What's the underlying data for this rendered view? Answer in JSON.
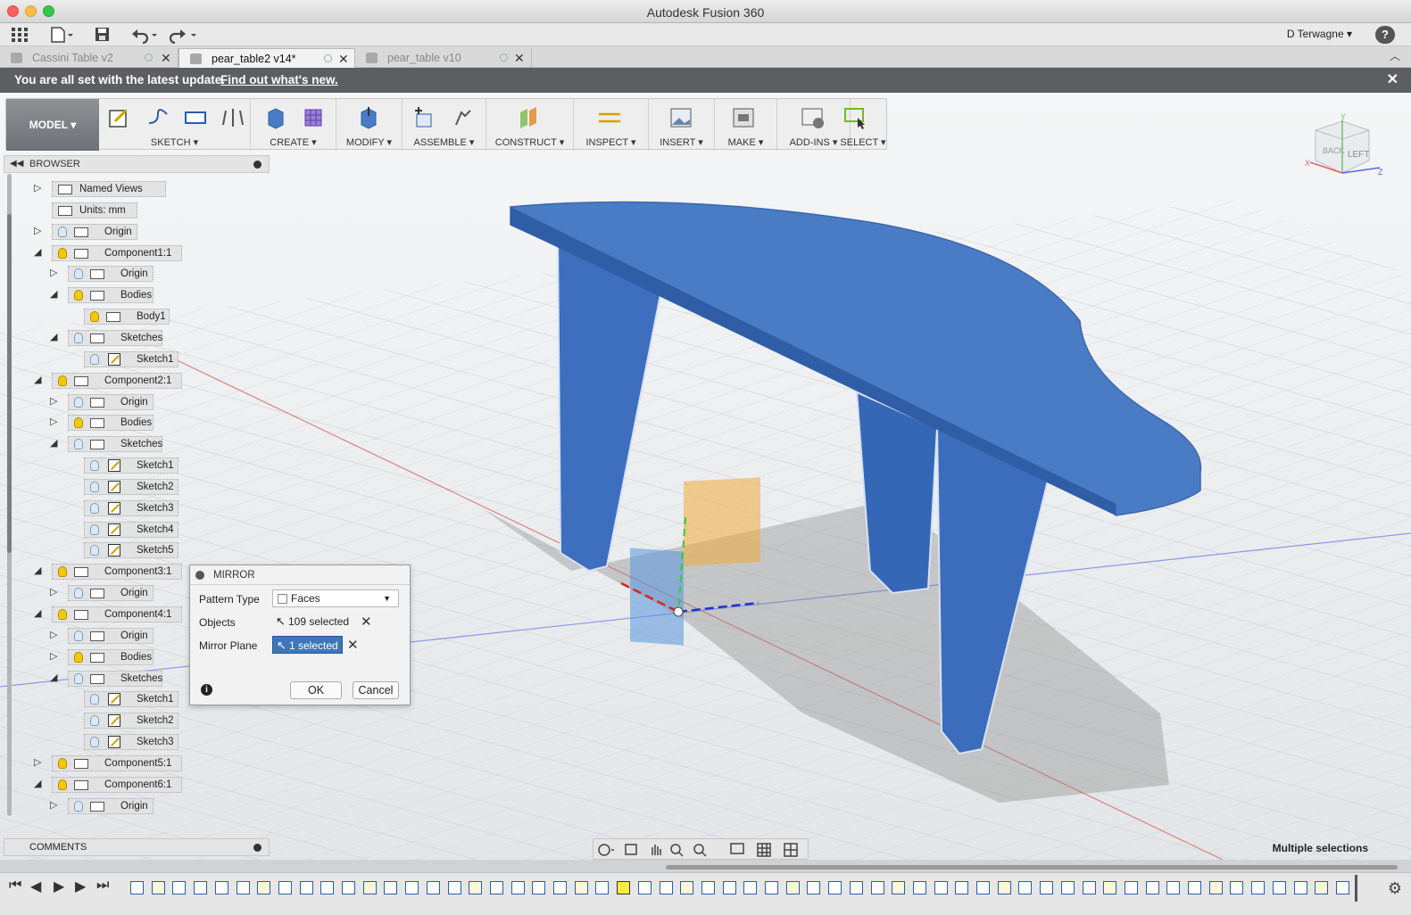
{
  "window": {
    "title": "Autodesk Fusion 360"
  },
  "qat": {
    "user": "D Terwagne",
    "help": "?"
  },
  "tabs": [
    {
      "label": "Cassini Table v2"
    },
    {
      "label": "pear_table2 v14*"
    },
    {
      "label": "pear_table v10"
    }
  ],
  "banner": {
    "message": "You are all set with the latest update.",
    "link": "Find out what's new."
  },
  "toolbar": {
    "workspace": "MODEL ▾",
    "groups": [
      "SKETCH ▾",
      "CREATE ▾",
      "MODIFY ▾",
      "ASSEMBLE ▾",
      "CONSTRUCT ▾",
      "INSPECT ▾",
      "INSERT ▾",
      "MAKE ▾",
      "ADD-INS ▾",
      "SELECT ▾"
    ]
  },
  "browser": {
    "title": "BROWSER",
    "items": [
      {
        "label": "Named Views"
      },
      {
        "label": "Units: mm"
      },
      {
        "label": "Origin"
      },
      {
        "label": "Component1:1"
      },
      {
        "label": "Origin"
      },
      {
        "label": "Bodies"
      },
      {
        "label": "Body1"
      },
      {
        "label": "Sketches"
      },
      {
        "label": "Sketch1"
      },
      {
        "label": "Component2:1"
      },
      {
        "label": "Origin"
      },
      {
        "label": "Bodies"
      },
      {
        "label": "Sketches"
      },
      {
        "label": "Sketch1"
      },
      {
        "label": "Sketch2"
      },
      {
        "label": "Sketch3"
      },
      {
        "label": "Sketch4"
      },
      {
        "label": "Sketch5"
      },
      {
        "label": "Component3:1"
      },
      {
        "label": "Origin"
      },
      {
        "label": "Component4:1"
      },
      {
        "label": "Origin"
      },
      {
        "label": "Bodies"
      },
      {
        "label": "Sketches"
      },
      {
        "label": "Sketch1"
      },
      {
        "label": "Sketch2"
      },
      {
        "label": "Sketch3"
      },
      {
        "label": "Component5:1"
      },
      {
        "label": "Component6:1"
      },
      {
        "label": "Origin"
      }
    ]
  },
  "mirror": {
    "title": "MIRROR",
    "pattern_type_label": "Pattern Type",
    "pattern_type_value": "Faces",
    "objects_label": "Objects",
    "objects_value": "109 selected",
    "plane_label": "Mirror Plane",
    "plane_value": "1 selected",
    "ok": "OK",
    "cancel": "Cancel"
  },
  "viewcube": {
    "back": "BACK",
    "left": "LEFT",
    "x": "X",
    "y": "Y",
    "z": "Z"
  },
  "comments": {
    "label": "COMMENTS"
  },
  "status": {
    "text": "Multiple selections"
  },
  "colors": {
    "model": "#4a7cc6",
    "banner": "#5b5f62",
    "selection": "#3e77b8"
  }
}
